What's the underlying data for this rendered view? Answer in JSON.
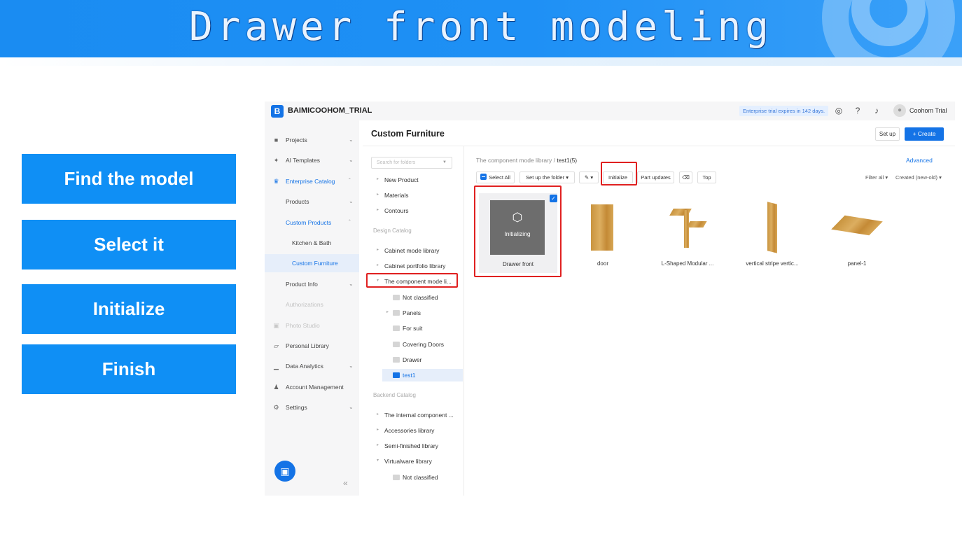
{
  "banner": {
    "title": "Drawer front modeling"
  },
  "steps": [
    {
      "label": "Find the model"
    },
    {
      "label": "Select it"
    },
    {
      "label": "Initialize"
    },
    {
      "label": "Finish"
    }
  ],
  "app": {
    "topbar": {
      "logo_letter": "B",
      "brand": "BAIMICOOHOM_TRIAL",
      "trial_notice": "Enterprise trial expires in 142 days.",
      "user_name": "Coohom Trial"
    },
    "sidebar": {
      "items": [
        {
          "label": "Projects"
        },
        {
          "label": "AI Templates"
        },
        {
          "label": "Enterprise Catalog"
        },
        {
          "label": "Products"
        },
        {
          "label": "Custom Products"
        },
        {
          "label": "Kitchen & Bath"
        },
        {
          "label": "Custom Furniture"
        },
        {
          "label": "Product Info"
        },
        {
          "label": "Authorizations"
        },
        {
          "label": "Photo Studio"
        },
        {
          "label": "Personal Library"
        },
        {
          "label": "Data Analytics"
        },
        {
          "label": "Account Management"
        },
        {
          "label": "Settings"
        }
      ]
    },
    "page_title": "Custom Furniture",
    "setup_label": "Set up",
    "create_label": "+ Create",
    "tree": {
      "search_placeholder": "Search for folders",
      "top_items": [
        "New Product",
        "Materials",
        "Contours"
      ],
      "design_catalog_label": "Design Catalog",
      "design_items": [
        "Cabinet mode library",
        "Cabinet portfolio library",
        "The component mode li..."
      ],
      "sub_items": [
        "Not classified",
        "Panels",
        "For suit",
        "Covering Doors",
        "Drawer",
        "test1"
      ],
      "backend_catalog_label": "Backend Catalog",
      "backend_items": [
        "The internal component ...",
        "Accessories library",
        "Semi-finished library",
        "Virtualware library"
      ],
      "backend_sub": [
        "Not classified"
      ]
    },
    "content": {
      "breadcrumb_root": "The component mode library",
      "breadcrumb_current": "test1(5)",
      "advanced_label": "Advanced",
      "toolbar": {
        "select_all": "Select All",
        "set_up_folder": "Set up the folder",
        "initialize": "Initialize",
        "part_updates": "Part updates",
        "top": "Top"
      },
      "filter_all": "Filter all",
      "sort": "Created (new-old)",
      "initializing_label": "Initializing",
      "cards": [
        {
          "name": "Drawer front"
        },
        {
          "name": "door"
        },
        {
          "name": "L-Shaped Modular ..."
        },
        {
          "name": "vertical stripe vertic..."
        },
        {
          "name": "panel-1"
        }
      ]
    }
  }
}
